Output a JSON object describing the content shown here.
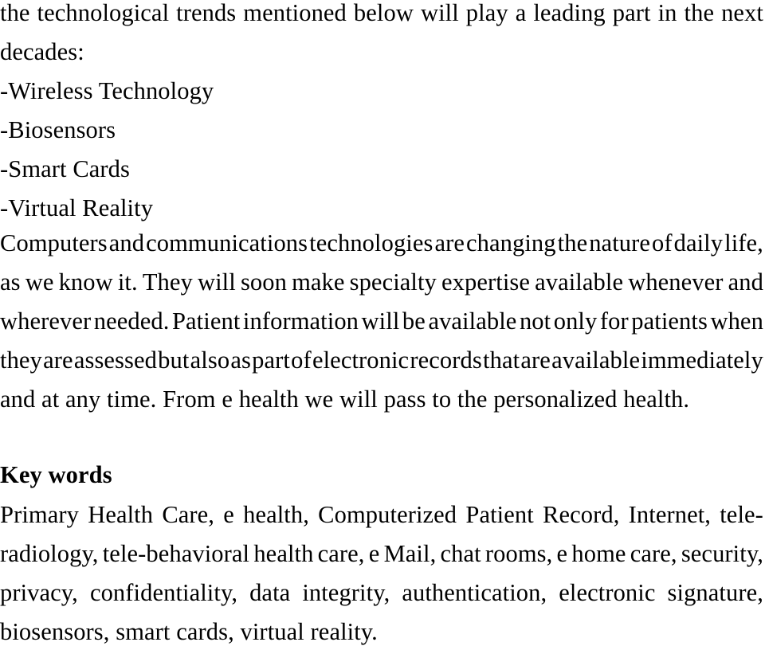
{
  "document": {
    "type": "scanned-article-page",
    "background_color": "#ffffff",
    "text_color": "#000000",
    "paragraph_intro": {
      "lines": [
        {
          "justified": true,
          "words": [
            "the",
            "technological",
            "trends",
            "mentioned",
            "below",
            "will",
            "play",
            "a",
            "leading",
            "part",
            "in",
            "the",
            "next"
          ]
        },
        {
          "justified": false,
          "text": "decades:"
        }
      ],
      "full_text": "the technological trends mentioned below will play a leading part in the next decades:"
    },
    "trend_list": {
      "items": [
        {
          "marker": "-",
          "label": "Wireless Technology"
        },
        {
          "marker": "-",
          "label": "Biosensors"
        },
        {
          "marker": "-",
          "label": "Smart Cards"
        },
        {
          "marker": "-",
          "label": "Virtual Reality"
        }
      ]
    },
    "body_paragraph": {
      "lines": [
        {
          "justified": true,
          "words": [
            "Computers",
            "and",
            "communications",
            "technologies",
            "are",
            "changing",
            "the",
            "nature",
            "of",
            "daily",
            "life,"
          ]
        },
        {
          "justified": true,
          "words": [
            "as",
            "we",
            "know",
            "it.",
            "They",
            "will",
            "soon",
            "make",
            "specialty",
            "expertise",
            "available",
            "whenever",
            "and"
          ]
        },
        {
          "justified": true,
          "words": [
            "wherever",
            "needed.",
            "Patient",
            "information",
            "will",
            "be",
            "available",
            "not",
            "only",
            "for",
            "patients",
            "when"
          ]
        },
        {
          "justified": true,
          "words": [
            "they",
            "are",
            "assessed",
            "but",
            "also",
            "as",
            "part",
            "of",
            "electronic",
            "records",
            "that",
            "are",
            "available",
            "immediately"
          ]
        },
        {
          "justified": false,
          "text": "and at any time. From e health we will pass to the personalized health."
        }
      ],
      "full_text": "Computers and communications technologies are changing the nature of daily life, as we know it. They will soon make specialty expertise available whenever and wherever needed. Patient information will be available not only for patients when they are assessed but also as part of electronic records that are available immediately and at any time. From e health we will pass to the personalized health."
    },
    "keywords_section": {
      "heading": "Key words",
      "lines": [
        {
          "justified": true,
          "words": [
            "Primary",
            "Health",
            "Care,",
            "e",
            "health,",
            "Computerized",
            "Patient",
            "Record,",
            "Internet,",
            "tele-"
          ]
        },
        {
          "justified": true,
          "words": [
            "radiology,",
            "tele-behavioral",
            "health",
            "care,",
            "e",
            "Mail,",
            "chat",
            "rooms,",
            "e",
            "home",
            "care,",
            "security,"
          ]
        },
        {
          "justified": true,
          "words": [
            "privacy,",
            "confidentiality,",
            "data",
            "integrity,",
            "authentication,",
            "electronic",
            "signature,"
          ]
        },
        {
          "justified": false,
          "text": "biosensors, smart cards, virtual reality."
        }
      ],
      "full_text": "Primary Health Care, e health, Computerized Patient Record, Internet, tele-radiology, tele-behavioral health care, e Mail, chat rooms, e home care, security, privacy, confidentiality, data integrity, authentication, electronic signature, biosensors, smart cards, virtual reality.",
      "terms": [
        "Primary Health Care",
        "e health",
        "Computerized Patient Record",
        "Internet",
        "tele-radiology",
        "tele-behavioral health care",
        "e Mail",
        "chat rooms",
        "e home care",
        "security",
        "privacy",
        "confidentiality",
        "data integrity",
        "authentication",
        "electronic signature",
        "biosensors",
        "smart cards",
        "virtual reality"
      ]
    }
  }
}
